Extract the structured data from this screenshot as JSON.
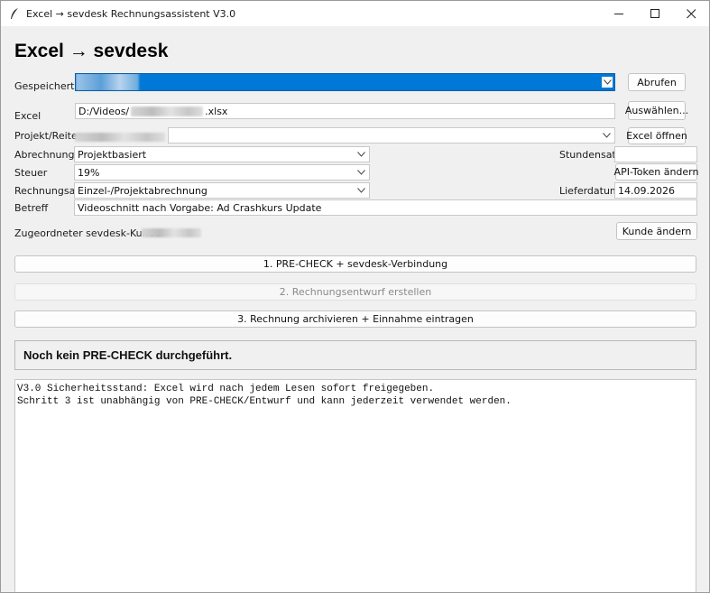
{
  "window": {
    "title": "Excel → sevdesk Rechnungsassistent V3.0",
    "controls": {
      "minimize": "—",
      "maximize": "☐",
      "close": "✕"
    }
  },
  "heading": "Excel → sevdesk",
  "saved": {
    "label": "Gespeichert",
    "fetch_button": "Abrufen"
  },
  "excel": {
    "label": "Excel",
    "path_prefix": "D:/Videos/",
    "path_suffix": ".xlsx",
    "select_button": "Auswählen..."
  },
  "project": {
    "label": "Projekt/Reiter",
    "open_button": "Excel öffnen"
  },
  "billing": {
    "label": "Abrechnung",
    "value": "Projektbasiert",
    "hourly_rate_label": "Stundensatz"
  },
  "tax": {
    "label": "Steuer",
    "value": "19%",
    "token_button": "API-Token ändern"
  },
  "invoice_type": {
    "label": "Rechnungsart",
    "value": "Einzel-/Projektabrechnung",
    "delivery_date_label": "Lieferdatum",
    "delivery_date": "14.09.2026"
  },
  "subject": {
    "label": "Betreff",
    "value": "Videoschnitt nach Vorgabe: Ad Crashkurs Update"
  },
  "customer": {
    "label": "Zugeordneter sevdesk-Kunde:",
    "change_button": "Kunde ändern"
  },
  "steps": {
    "step1": "1. PRE-CHECK + sevdesk-Verbindung",
    "step2": "2. Rechnungsentwurf erstellen",
    "step3": "3. Rechnung archivieren + Einnahme eintragen"
  },
  "status": "Noch kein PRE-CHECK durchgeführt.",
  "log_lines": [
    "V3.0 Sicherheitsstand: Excel wird nach jedem Lesen sofort freigegeben.",
    "Schritt 3 ist unabhängig von PRE-CHECK/Entwurf und kann jederzeit verwendet werden."
  ],
  "colors": {
    "selection": "#0078d7",
    "window_bg": "#f0f0f0"
  }
}
